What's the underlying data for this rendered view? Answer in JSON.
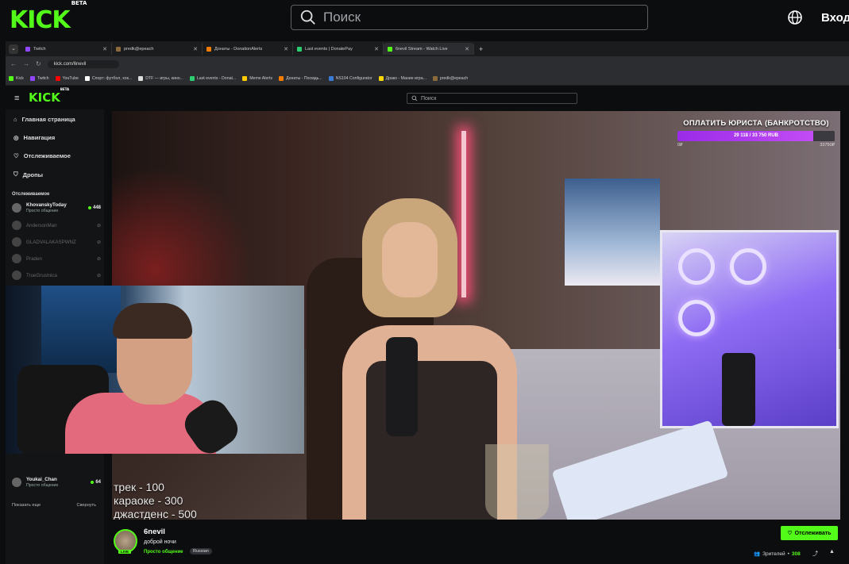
{
  "outer": {
    "logo": "KICK",
    "logo_badge": "BETA",
    "search_placeholder": "Поиск",
    "login_label": "Вход"
  },
  "browser": {
    "tabs": [
      {
        "label": "Twitch",
        "color": "#9146ff"
      },
      {
        "label": "predk@epeach",
        "color": "#8a6a3a"
      },
      {
        "label": "Донаты - DonationAlerts",
        "color": "#f57c00"
      },
      {
        "label": "Last events | DonatePay",
        "color": "#2ecc71"
      },
      {
        "label": "6nevil Stream - Watch Live",
        "color": "#53fc18"
      }
    ],
    "url": "kick.com/6nevil",
    "bookmarks": [
      {
        "label": "Kick",
        "color": "#53fc18"
      },
      {
        "label": "Twitch",
        "color": "#9146ff"
      },
      {
        "label": "YouTube",
        "color": "#ff0000"
      },
      {
        "label": "Спорт: футбол, хок...",
        "color": "#ffffff"
      },
      {
        "label": "DTF — игры, кино...",
        "color": "#dddddd"
      },
      {
        "label": "Last events - Donat...",
        "color": "#2ecc71"
      },
      {
        "label": "Meme Alerts",
        "color": "#ffcc00"
      },
      {
        "label": "Донаты - Посмдь...",
        "color": "#f57c00"
      },
      {
        "label": "NS104 Configurator",
        "color": "#3a7bd5"
      },
      {
        "label": "Драко - Мание игра...",
        "color": "#ffd700"
      },
      {
        "label": "predk@epeach",
        "color": "#8a6a3a"
      }
    ]
  },
  "inner": {
    "logo": "KICK",
    "logo_badge": "BETA",
    "search_placeholder": "Поиск",
    "nav": [
      {
        "label": "Главная страница",
        "icon": "home-icon"
      },
      {
        "label": "Навигация",
        "icon": "compass-icon"
      },
      {
        "label": "Отслеживаемое",
        "icon": "heart-icon"
      },
      {
        "label": "Дропы",
        "icon": "drops-icon"
      }
    ],
    "following_title": "Отслеживаемое",
    "following": [
      {
        "name": "KhovanskyToday",
        "sub": "Просто общение",
        "count": "448",
        "live": true
      },
      {
        "name": "AndersonMan",
        "sub": "",
        "count": "",
        "live": false
      },
      {
        "name": "GLADVALAKASPWNZ",
        "sub": "",
        "count": "",
        "live": false
      },
      {
        "name": "Praden",
        "sub": "",
        "count": "",
        "live": false
      },
      {
        "name": "TrueGrustnica",
        "sub": "",
        "count": "",
        "live": false
      }
    ],
    "following_bottom": {
      "name": "Youkai_Chan",
      "sub": "Просто общение",
      "count": "64"
    },
    "show_more": "Показать еще",
    "collapse": "Свернуть"
  },
  "goal": {
    "title": "ОПЛАТИТЬ ЮРИСТА (БАНКРОТСТВО)",
    "progress_text": "29 118 / 33 750 RUB",
    "progress": 0.8628,
    "min": "0₽",
    "max": "33750₽"
  },
  "prices": [
    "трек - 100",
    "караоке - 300",
    "джастденс - 500"
  ],
  "stream": {
    "name": "6nevil",
    "title": "доброй ночи",
    "category": "Просто общение",
    "language": "Russian",
    "live_label": "LIVE",
    "follow_label": "Отслеживать",
    "viewers_label": "Зрителей",
    "viewers_count": "308"
  }
}
